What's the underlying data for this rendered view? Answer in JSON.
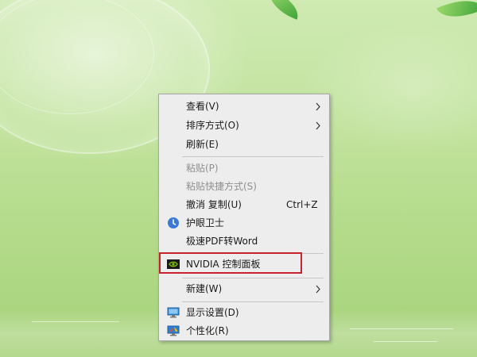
{
  "context_menu": {
    "items": [
      {
        "label": "查看(V)",
        "has_submenu": true
      },
      {
        "label": "排序方式(O)",
        "has_submenu": true
      },
      {
        "label": "刷新(E)"
      },
      {
        "label": "粘贴(P)",
        "disabled": true
      },
      {
        "label": "粘贴快捷方式(S)",
        "disabled": true
      },
      {
        "label": "撤消 复制(U)",
        "shortcut": "Ctrl+Z"
      },
      {
        "label": "护眼卫士",
        "icon": "eye-guard-icon"
      },
      {
        "label": "极速PDF转Word"
      },
      {
        "label": "NVIDIA 控制面板",
        "icon": "nvidia-icon",
        "highlighted": true
      },
      {
        "label": "新建(W)",
        "has_submenu": true
      },
      {
        "label": "显示设置(D)",
        "icon": "display-settings-icon"
      },
      {
        "label": "个性化(R)",
        "icon": "personalize-icon"
      }
    ]
  },
  "colors": {
    "highlight_border": "#c8232c",
    "disabled_text": "#8f8f8f",
    "eye_guard_accent": "#3c78d8",
    "nvidia_green": "#76b900"
  }
}
